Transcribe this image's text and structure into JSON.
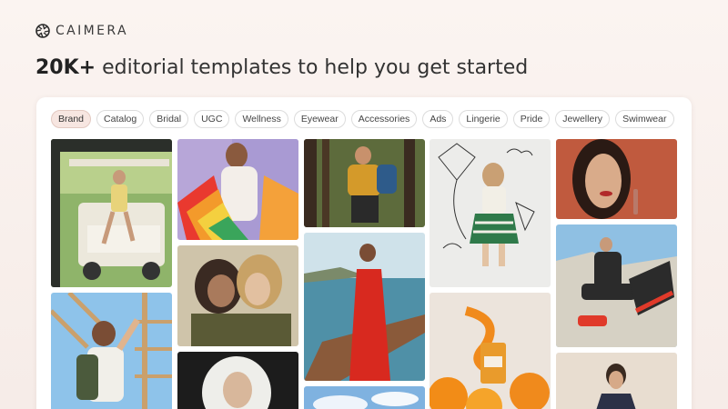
{
  "brand": {
    "name": "CAIMERA"
  },
  "headline": {
    "bold": "20K+",
    "rest": " editorial templates to help you get started"
  },
  "filters": {
    "active": "Brand",
    "items": [
      "Brand",
      "Catalog",
      "Bridal",
      "UGC",
      "Wellness",
      "Eyewear",
      "Accessories",
      "Ads",
      "Lingerie",
      "Pride",
      "Jewellery",
      "Swimwear"
    ]
  },
  "gallery": {
    "tiles": [
      "golf-cart-fashion-photo",
      "pride-flag-portrait-photo",
      "forest-hiker-photo",
      "kite-doodle-girl-photo",
      "lip-gloss-beauty-photo",
      "two-women-portrait-photo",
      "red-dress-yacht-photo",
      "orange-serum-product-photo",
      "boy-climbing-frame-photo",
      "rock-sneakers-photo",
      "white-scarf-portrait-photo",
      "blue-sky-clouds-photo",
      "man-jacket-portrait-photo"
    ]
  },
  "colors": {
    "accent": "#f7e6e1",
    "background": "#fbf4f1"
  }
}
